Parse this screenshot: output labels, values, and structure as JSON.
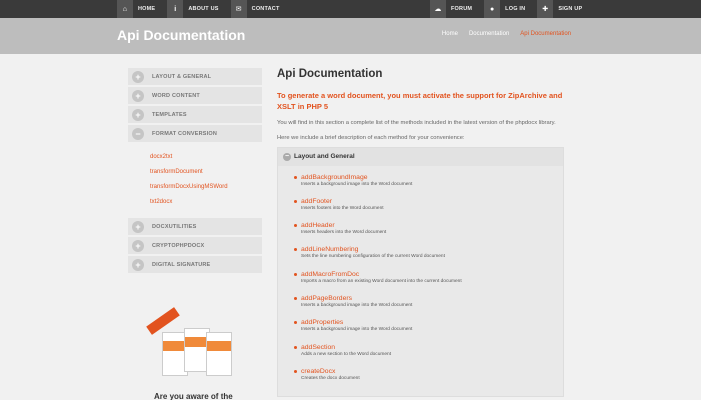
{
  "topbar": {
    "left": [
      {
        "icon": "home-icon",
        "glyph": "⌂",
        "label": "HOME"
      },
      {
        "icon": "info-icon",
        "glyph": "i",
        "label": "ABOUT US"
      },
      {
        "icon": "mail-icon",
        "glyph": "✉",
        "label": "CONTACT"
      }
    ],
    "right": [
      {
        "icon": "chat-icon",
        "glyph": "☁",
        "label": "FORUM"
      },
      {
        "icon": "user-icon",
        "glyph": "●",
        "label": "LOG IN"
      },
      {
        "icon": "user-add-icon",
        "glyph": "✚",
        "label": "SIGN UP"
      }
    ]
  },
  "header": {
    "title": "Api Documentation",
    "breadcrumb": [
      "Home",
      "Documentation",
      "Api Documentation"
    ]
  },
  "sidebar": {
    "sections": [
      {
        "label": "LAYOUT & GENERAL",
        "toggle": "+"
      },
      {
        "label": "WORD CONTENT",
        "toggle": "+"
      },
      {
        "label": "TEMPLATES",
        "toggle": "+"
      },
      {
        "label": "FORMAT CONVERSION",
        "toggle": "−"
      }
    ],
    "sub_items": [
      "docx2txt",
      "transformDocument",
      "transformDocxUsingMSWord",
      "txt2docx"
    ],
    "sections_after": [
      {
        "label": "DOCXUTILITIES",
        "toggle": "+"
      },
      {
        "label": "CRYPTOPHPDOCX",
        "toggle": "+"
      },
      {
        "label": "DIGITAL SIGNATURE",
        "toggle": "+"
      }
    ],
    "promo_text": "Are you aware of the"
  },
  "main": {
    "title": "Api Documentation",
    "notice": "To generate a word document, you must activate the support for ZipArchive and XSLT in PHP 5",
    "intro": "You will find in this section a complete list of the methods included in the latest version of the phpdocx library.",
    "intro2": "Here we include a brief description of each method for your convenience:",
    "panel_title": "Layout and General",
    "panel_toggle": "−",
    "methods": [
      {
        "name": "addBackgroundImage",
        "desc": "Inserts a background image into the Word document"
      },
      {
        "name": "addFooter",
        "desc": "Inserts footers into the Word document"
      },
      {
        "name": "addHeader",
        "desc": "Inserts headers into the Word document"
      },
      {
        "name": "addLineNumbering",
        "desc": "Sets the line numbering configuration of the current Word document"
      },
      {
        "name": "addMacroFromDoc",
        "desc": "Imports a macro from an existing Word document into the current document"
      },
      {
        "name": "addPageBorders",
        "desc": "Inserts a background image into the Word document"
      },
      {
        "name": "addProperties",
        "desc": "Inserts a background image into the Word document"
      },
      {
        "name": "addSection",
        "desc": "Adds a new section to the Word document"
      },
      {
        "name": "createDocx",
        "desc": "Creates the docx document"
      }
    ]
  },
  "colors": {
    "accent": "#e2531f",
    "topbar": "#3a3a3a",
    "header": "#bdbdbd"
  }
}
